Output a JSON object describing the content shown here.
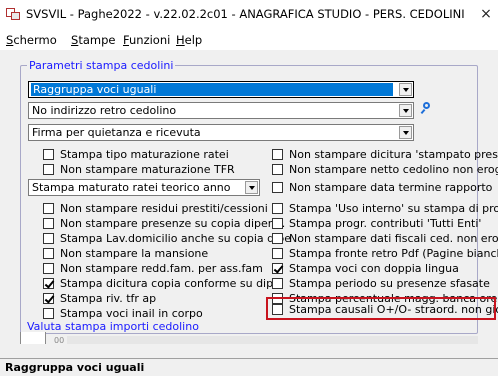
{
  "window": {
    "title": "SVSVIL - Paghe2022 - v.22.02.2c01 - ANAGRAFICA STUDIO - PERS. CEDOLINI",
    "close_glyph": "×"
  },
  "menu": [
    {
      "label_u": "S",
      "label_rest": "chermo"
    },
    {
      "label_u": "S",
      "label_rest": "tampe"
    },
    {
      "label_u": "F",
      "label_rest": "unzioni"
    },
    {
      "label_u": "H",
      "label_rest": "elp"
    }
  ],
  "group": {
    "title": "Parametri stampa cedolini",
    "combo_1": "Raggruppa voci uguali",
    "combo_2": "No indirizzo retro cedolino",
    "combo_3": "Firma per quietanza e ricevuta",
    "combo_maturato": "Stampa maturato ratei teorico anno"
  },
  "left_checks": [
    {
      "label": "Stampa tipo maturazione ratei",
      "checked": false
    },
    {
      "label": "Non stampare maturazione TFR",
      "checked": false
    },
    {
      "label": "Non stampare residui prestiti/cessioni",
      "checked": false
    },
    {
      "label": "Non stampare presenze su copia dipend.",
      "checked": false
    },
    {
      "label": "Stampa Lav.domicilio anche su copia dipe",
      "checked": false
    },
    {
      "label": "Non stampare la mansione",
      "checked": false
    },
    {
      "label": "Non stampare redd.fam. per ass.fam",
      "checked": false
    },
    {
      "label": "Stampa dicitura copia conforme su dipe",
      "checked": true
    },
    {
      "label": "Stampa riv. tfr ap",
      "checked": true
    },
    {
      "label": "Stampa voci inail in corpo",
      "checked": false
    }
  ],
  "right_checks": [
    {
      "label": "Non stampare dicitura 'stampato presso'",
      "checked": false
    },
    {
      "label": "Non stampare netto cedolino non erogato",
      "checked": false
    },
    {
      "label": "Non stampare data termine rapporto",
      "checked": false
    },
    {
      "label": "Stampa 'Uso interno' su stampa di prova",
      "checked": false
    },
    {
      "label": "Stampa progr. contributi 'Tutti Enti'",
      "checked": false
    },
    {
      "label": "Non stampare dati fiscali ced. non erog.",
      "checked": false
    },
    {
      "label": "Stampa fronte retro Pdf (Pagine bianche)",
      "checked": false
    },
    {
      "label": "Stampa voci con doppia lingua",
      "checked": true
    },
    {
      "label": "Stampa periodo su presenze sfasate",
      "checked": false
    },
    {
      "label": "Stampa percentuale magg. banca ore",
      "checked": false
    },
    {
      "label": "Stampa causali O+/O- straord. non giorn.",
      "checked": false
    }
  ],
  "link_text": "Valuta stampa importi cedolino",
  "nav_icon": "00",
  "status_text": "Raggruppa voci uguali"
}
